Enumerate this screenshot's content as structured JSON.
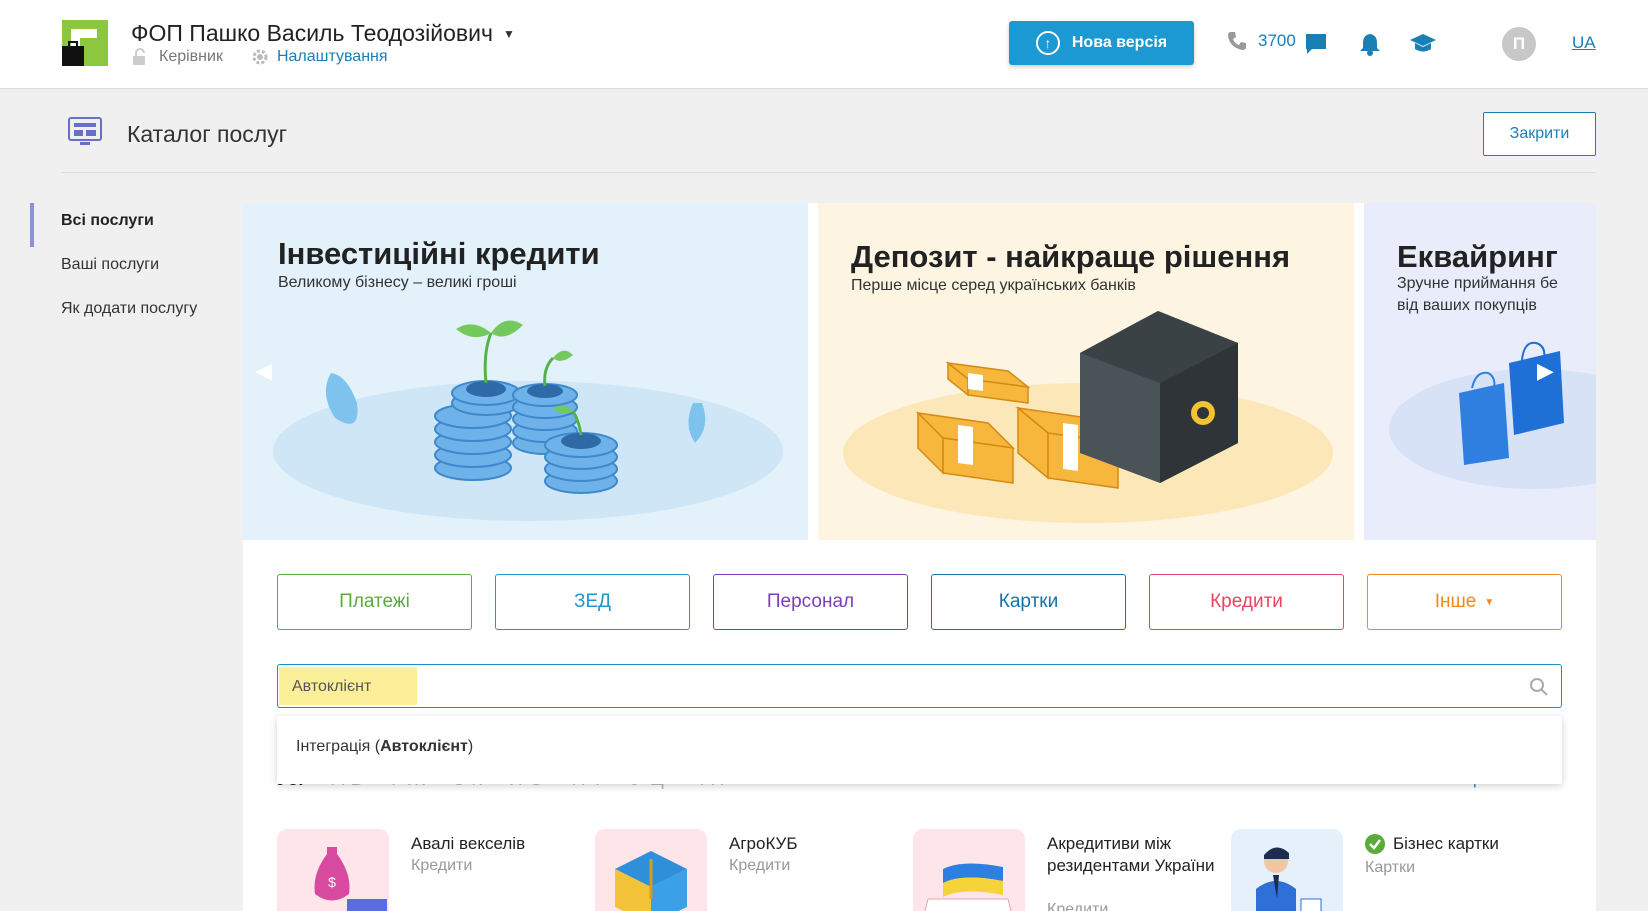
{
  "header": {
    "company": "ФОП Пашко Василь Теодозійович",
    "role": "Керівник",
    "settings": "Налаштування",
    "new_version": "Нова версія",
    "phone": "3700",
    "avatar_letter": "П",
    "lang": "UA"
  },
  "page": {
    "title": "Каталог послуг",
    "close": "Закрити"
  },
  "sidebar": {
    "items": [
      {
        "label": "Всі послуги"
      },
      {
        "label": "Ваші послуги"
      },
      {
        "label": "Як додати послугу"
      }
    ]
  },
  "banners": [
    {
      "title": "Інвестиційні кредити",
      "subtitle": "Великому бізнесу – великі гроші"
    },
    {
      "title": "Депозит - найкраще рішення",
      "subtitle": "Перше місце серед українських банків"
    },
    {
      "title": "Еквайринг",
      "subtitle": "Зручне приймання бе",
      "subtitle2": "від ваших покупців"
    }
  ],
  "categories": [
    {
      "label": "Платежі",
      "color": "#5aab3a"
    },
    {
      "label": "ЗЕД",
      "color": "#1c98d2"
    },
    {
      "label": "Персонал",
      "color": "#7a3fb8"
    },
    {
      "label": "Картки",
      "color": "#1672a8"
    },
    {
      "label": "Кредити",
      "color": "#e8455e"
    },
    {
      "label": "Інше",
      "color": "#f0891a"
    }
  ],
  "search": {
    "value": "Автоклієнт",
    "suggestion_prefix": "Інтеграція (",
    "suggestion_bold": "Автоклієнт",
    "suggestion_suffix": ")"
  },
  "letters": [
    "Усі",
    "А-В",
    "Г-Ж",
    "З-К",
    "Л-О",
    "П-Т",
    "У-Ц",
    "Ч-Я"
  ],
  "sort_label": "За алфавітом",
  "services": [
    {
      "name": "Авалі векселів",
      "category": "Кредити"
    },
    {
      "name": "АгроКУБ",
      "category": "Кредити"
    },
    {
      "name": "Акредитиви між резидентами України",
      "category": "Кредити"
    },
    {
      "name": "Бізнес картки",
      "category": "Картки"
    }
  ],
  "colors": {
    "brand_green": "#8dc63f",
    "accent_blue": "#1c98d2",
    "link_blue": "#1a7fb4"
  }
}
